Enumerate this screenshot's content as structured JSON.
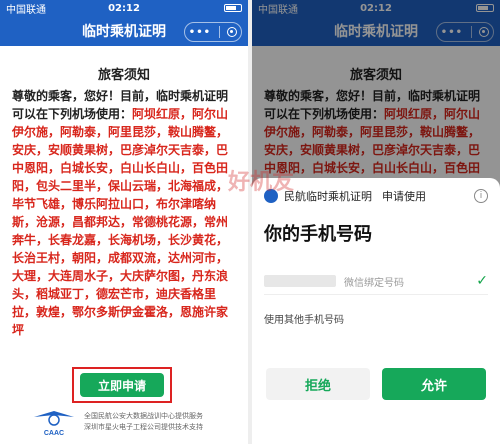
{
  "statusbar": {
    "carrier": "中国联通",
    "time": "02:12"
  },
  "navbar": {
    "title": "临时乘机证明",
    "menu": "•••"
  },
  "notice": {
    "title": "旅客须知",
    "intro": "尊敬的乘客，您好！目前，临时乘机证明可以在下列机场使用：",
    "airports": "阿坝红原，阿尔山伊尔施，阿勒泰，阿里昆莎，鞍山腾鳌，安庆，安顺黄果树，巴彦淖尔天吉泰，巴中恩阳，白城长安，白山长白山，百色田阳，包头二里半，保山云瑞，北海福成，毕节飞雄，博乐阿拉山口，布尔津喀纳斯，沧源，昌都邦达，常德桃花源，常州奔牛，长春龙嘉，长海机场，长沙黄花，长治王村，朝阳，成都双流，达州河市，大理，大连周水子，大庆萨尔图，丹东浪头，稻城亚丁，德宏芒市，迪庆香格里拉，敦煌，鄂尔多斯伊金霍洛，恩施许家坪"
  },
  "apply_button": "立即申请",
  "footer": {
    "logo_text": "CAAC",
    "line1": "全国民航公安大数据战训中心提供服务",
    "line2": "深圳市星火电子工程公司提供技术支持"
  },
  "sheet": {
    "app_name": "民航临时乘机证明",
    "apply_label": "申请使用",
    "title": "你的手机号码",
    "phone_hint": "微信绑定号码",
    "other_phone": "使用其他手机号码",
    "reject": "拒绝",
    "allow": "允许"
  },
  "watermark": "好机友",
  "colors": {
    "brand_blue": "#1f61c3",
    "accent_green": "#16a85a",
    "alert_red": "#d8261c"
  }
}
